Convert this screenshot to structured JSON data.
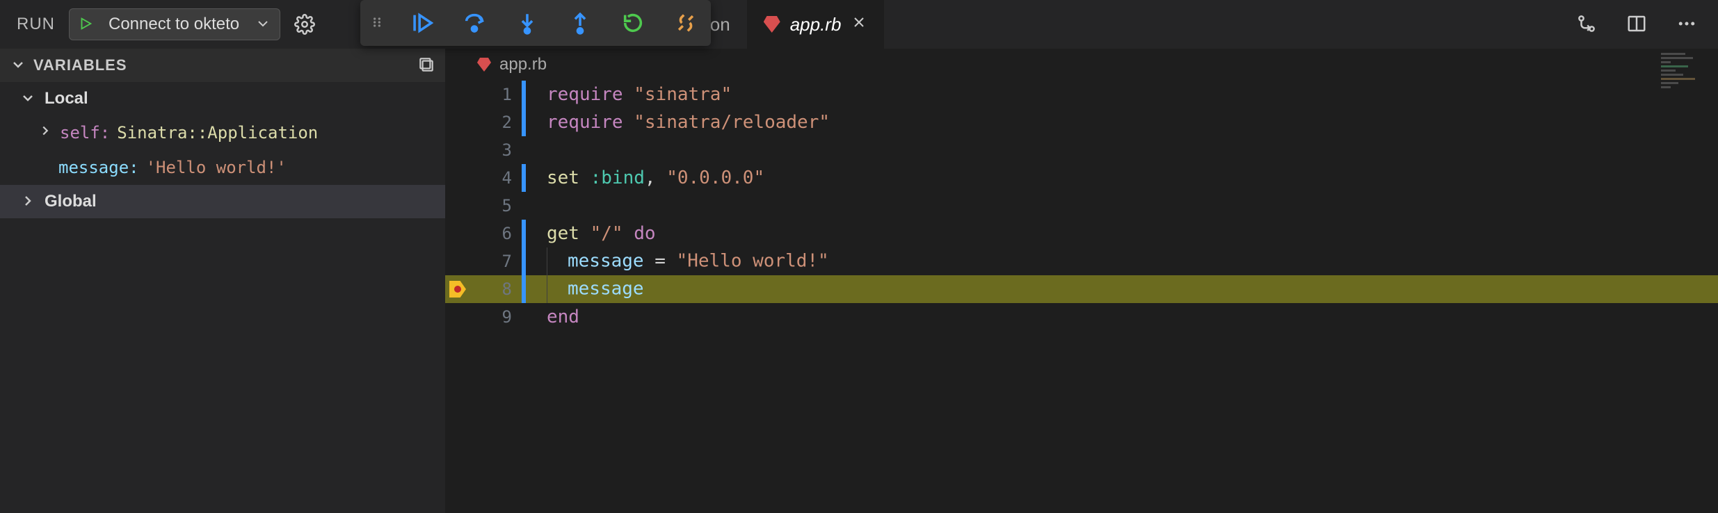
{
  "top": {
    "run_label": "RUN",
    "config_name": "Connect to okteto"
  },
  "tabs": {
    "inactive_suffix": "json",
    "active_title": "app.rb"
  },
  "sidebar": {
    "panel_title": "VARIABLES",
    "groups": {
      "local": "Local",
      "global": "Global"
    },
    "vars": {
      "self_key": "self:",
      "self_val": "Sinatra::Application",
      "msg_key": "message:",
      "msg_val": "'Hello world!'"
    }
  },
  "breadcrumb": {
    "file": "app.rb"
  },
  "code": {
    "lines": [
      {
        "n": "1",
        "cov": true,
        "tokens": [
          [
            "kw",
            "require"
          ],
          [
            "pl",
            " "
          ],
          [
            "str",
            "\"sinatra\""
          ]
        ]
      },
      {
        "n": "2",
        "cov": true,
        "tokens": [
          [
            "kw",
            "require"
          ],
          [
            "pl",
            " "
          ],
          [
            "str",
            "\"sinatra/reloader\""
          ]
        ]
      },
      {
        "n": "3",
        "cov": false,
        "tokens": []
      },
      {
        "n": "4",
        "cov": true,
        "tokens": [
          [
            "fn",
            "set"
          ],
          [
            "pl",
            " "
          ],
          [
            "sym",
            ":bind"
          ],
          [
            "pl",
            ", "
          ],
          [
            "str",
            "\"0.0.0.0\""
          ]
        ]
      },
      {
        "n": "5",
        "cov": false,
        "tokens": []
      },
      {
        "n": "6",
        "cov": true,
        "tokens": [
          [
            "fn",
            "get"
          ],
          [
            "pl",
            " "
          ],
          [
            "str",
            "\"/\""
          ],
          [
            "pl",
            " "
          ],
          [
            "kw",
            "do"
          ]
        ]
      },
      {
        "n": "7",
        "cov": true,
        "indent": 1,
        "tokens": [
          [
            "id",
            "message"
          ],
          [
            "pl",
            " = "
          ],
          [
            "str",
            "\"Hello world!\""
          ]
        ]
      },
      {
        "n": "8",
        "cov": true,
        "indent": 1,
        "current": true,
        "bp": true,
        "tokens": [
          [
            "id",
            "message"
          ]
        ]
      },
      {
        "n": "9",
        "cov": false,
        "tokens": [
          [
            "kw",
            "end"
          ]
        ]
      }
    ]
  }
}
